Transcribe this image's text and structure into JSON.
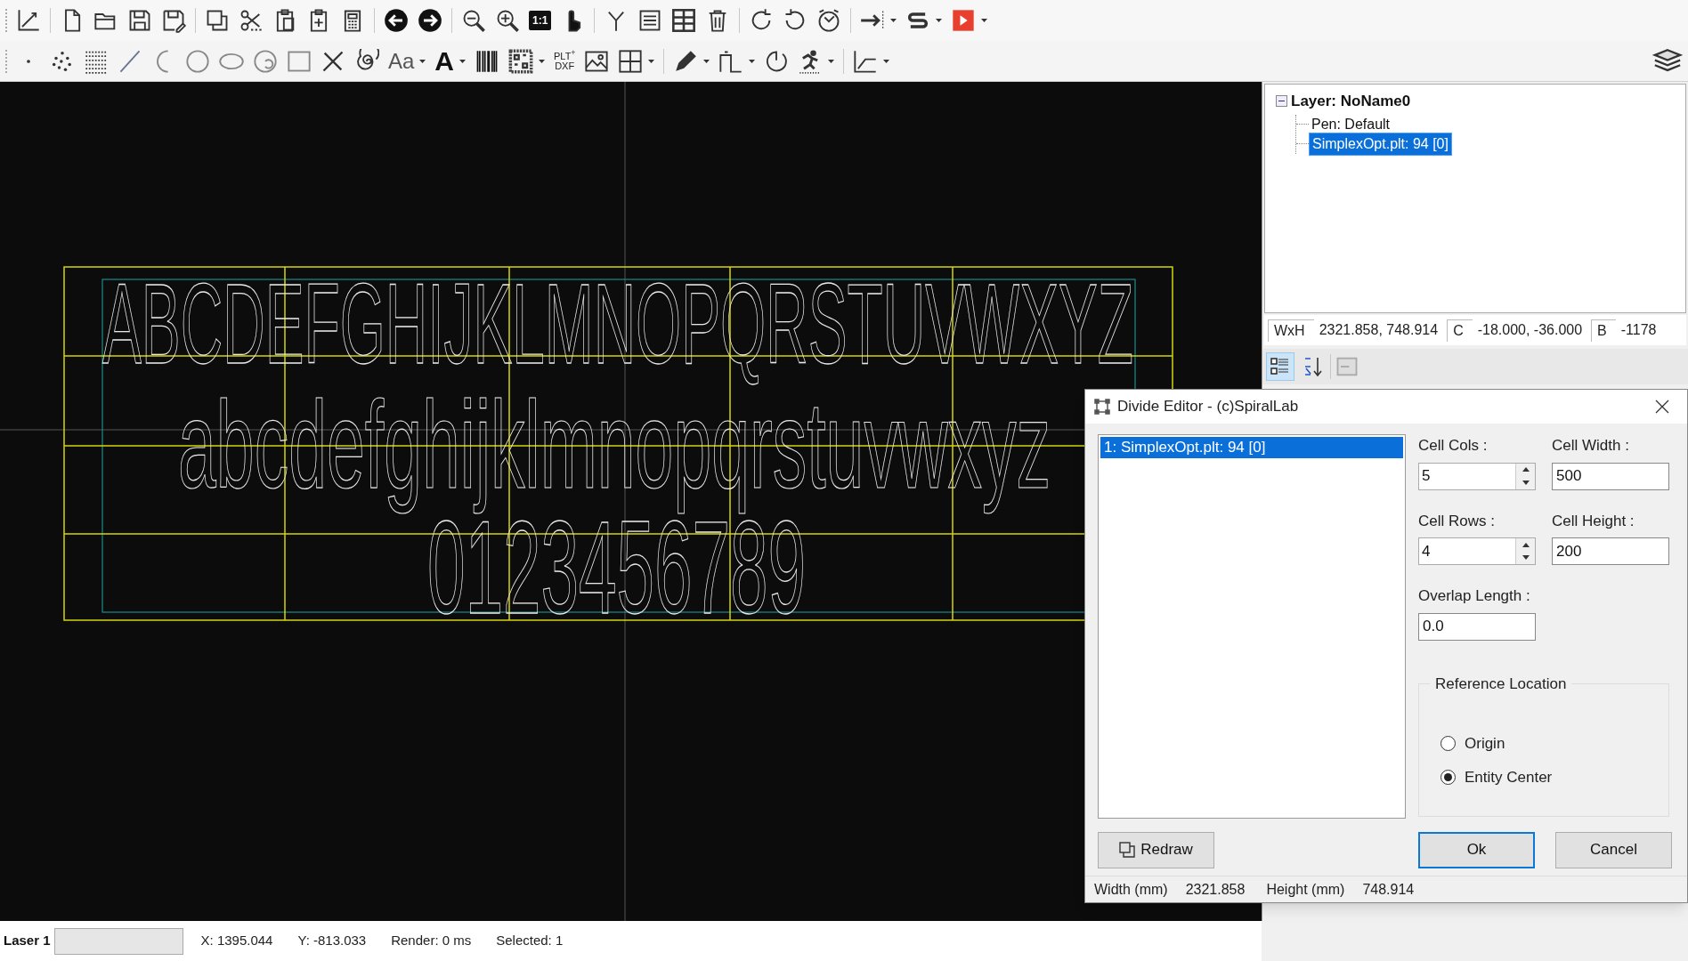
{
  "toolbar": {
    "actual_size_label": "1:1",
    "font_label": "Aa",
    "text_label": "A",
    "import_label_top": "PLT$^{+}$",
    "import_label_bottom": "DXF"
  },
  "canvas": {
    "text_lines": [
      "ABCDEFGHIJKLMNOPQRSTUVWXYZ",
      "abcdefghijklmnopqrstuvwxyz",
      "0123456789"
    ]
  },
  "tree": {
    "label": "Layer: NoName0",
    "expanded": true,
    "children": [
      {
        "label": "Pen: Default",
        "selected": false
      },
      {
        "label": "SimplexOpt.plt: 94 [0]",
        "selected": true
      }
    ]
  },
  "info_bar": [
    {
      "label": "WxH",
      "value": "2321.858, 748.914"
    },
    {
      "label": "C",
      "value": "-18.000, -36.000"
    },
    {
      "label": "B",
      "value": "-1178"
    }
  ],
  "property_toolbar": [
    {
      "kind": "categorized",
      "selected": true
    },
    {
      "kind": "alphabetical",
      "selected": false
    }
  ],
  "dialog": {
    "title": "Divide Editor - (c)SpiralLab",
    "entities": [
      {
        "label": "1: SimplexOpt.plt: 94 [0]",
        "selected": true
      }
    ],
    "fields": [
      {
        "kind": "spinner",
        "label": "Cell Cols :",
        "value": "5"
      },
      {
        "kind": "text",
        "label": "Cell Width :",
        "value": "500"
      },
      {
        "kind": "spinner",
        "label": "Cell Rows :",
        "value": "4"
      },
      {
        "kind": "text",
        "label": "Cell Height :",
        "value": "200"
      },
      {
        "kind": "text",
        "label": "Overlap Length :",
        "value": "0.0"
      }
    ],
    "reference_location": {
      "title": "Reference Location",
      "options": [
        {
          "label": "Origin",
          "selected": false
        },
        {
          "label": "Entity Center",
          "selected": true
        }
      ]
    },
    "buttons": [
      {
        "kind": "icon",
        "label": "Redraw"
      },
      {
        "kind": "default",
        "label": "Ok"
      },
      {
        "kind": "normal",
        "label": "Cancel"
      }
    ],
    "footer": [
      {
        "label": "Width (mm)",
        "value": "2321.858"
      },
      {
        "label": "Height (mm)",
        "value": "748.914"
      }
    ]
  },
  "status_bar": {
    "laser": "Laser 1",
    "x": "X: 1395.044",
    "y": "Y: -813.033",
    "render": "Render: 0 ms",
    "selected": "Selected: 1"
  }
}
